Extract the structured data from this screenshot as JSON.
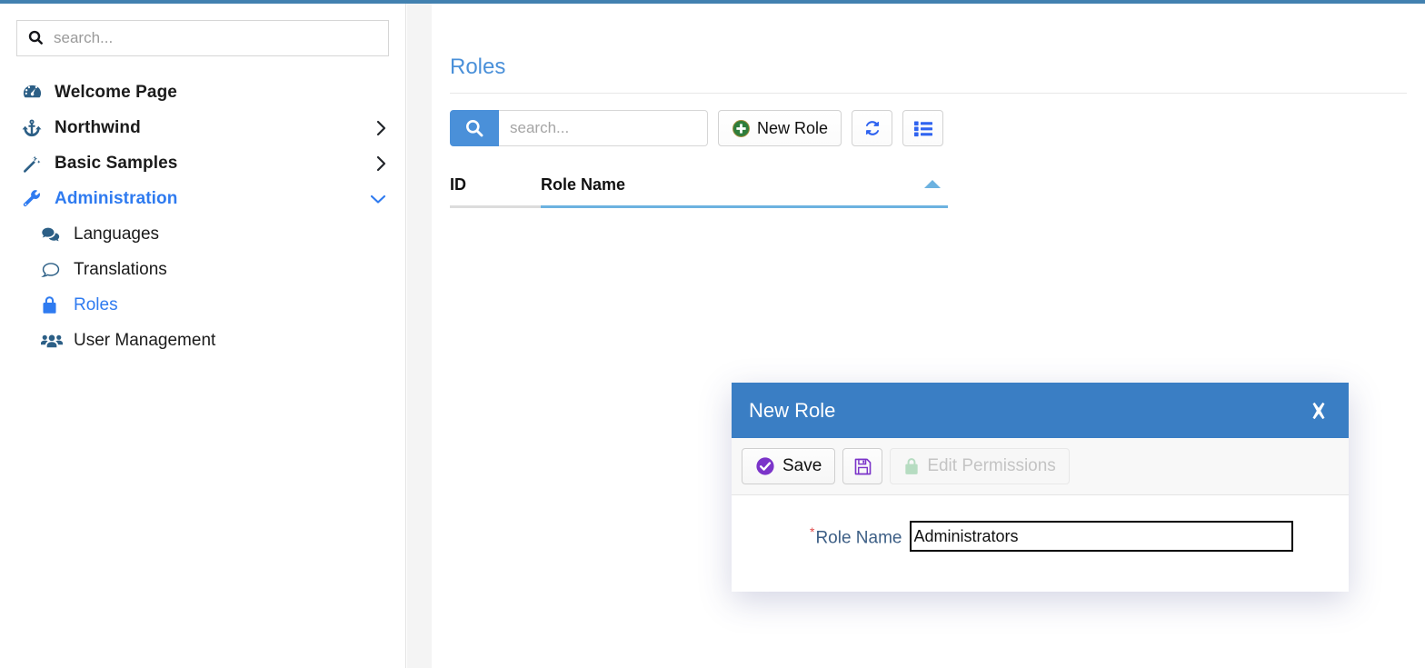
{
  "theme": {
    "top_bar_color": "#4281b0",
    "accent_blue": "#4a90d9",
    "active_link_blue": "#2f7bf0",
    "modal_header_blue": "#3a7ec4",
    "sort_indicator_blue": "#6cb2e0",
    "save_icon_purple": "#7b34c9",
    "new_role_icon_green": "#2f7d3b",
    "required_star_red": "#e04a4a"
  },
  "sidebar": {
    "search": {
      "placeholder": "search...",
      "value": "",
      "icon": "search-icon"
    },
    "items": [
      {
        "label": "Welcome Page",
        "icon": "dashboard-icon",
        "expandable": false,
        "active": false
      },
      {
        "label": "Northwind",
        "icon": "anchor-icon",
        "expandable": true,
        "chevron": "chevron-right-icon",
        "active": false
      },
      {
        "label": "Basic Samples",
        "icon": "magic-wand-icon",
        "expandable": true,
        "chevron": "chevron-right-icon",
        "active": false
      },
      {
        "label": "Administration",
        "icon": "wrench-icon",
        "expandable": true,
        "chevron": "chevron-down-icon",
        "active": true
      }
    ],
    "sub_items": [
      {
        "label": "Languages",
        "icon": "comments-icon",
        "active": false
      },
      {
        "label": "Translations",
        "icon": "comment-icon",
        "active": false
      },
      {
        "label": "Roles",
        "icon": "lock-icon",
        "active": true
      },
      {
        "label": "User Management",
        "icon": "users-icon",
        "active": false
      }
    ]
  },
  "main": {
    "title": "Roles",
    "toolbar": {
      "search_icon": "search-icon",
      "search_placeholder": "search...",
      "search_value": "",
      "new_role_label": "New Role",
      "new_role_icon": "plus-circle-icon",
      "refresh_icon": "refresh-icon",
      "columns_icon": "list-icon"
    },
    "table": {
      "columns": [
        {
          "label": "ID",
          "sorted": false
        },
        {
          "label": "Role Name",
          "sorted": true,
          "sort_direction": "asc",
          "sort_icon": "caret-up-icon"
        }
      ],
      "rows": []
    }
  },
  "modal": {
    "title": "New Role",
    "close_icon": "close-icon",
    "toolbar": {
      "save_label": "Save",
      "save_icon": "check-circle-icon",
      "save_draft_icon": "floppy-disk-icon",
      "edit_permissions_label": "Edit Permissions",
      "edit_permissions_icon": "lock-icon",
      "edit_permissions_disabled": true
    },
    "form": {
      "role_name_label": "Role Name",
      "role_name_required_marker": "*",
      "role_name_value": "Administrators"
    }
  }
}
